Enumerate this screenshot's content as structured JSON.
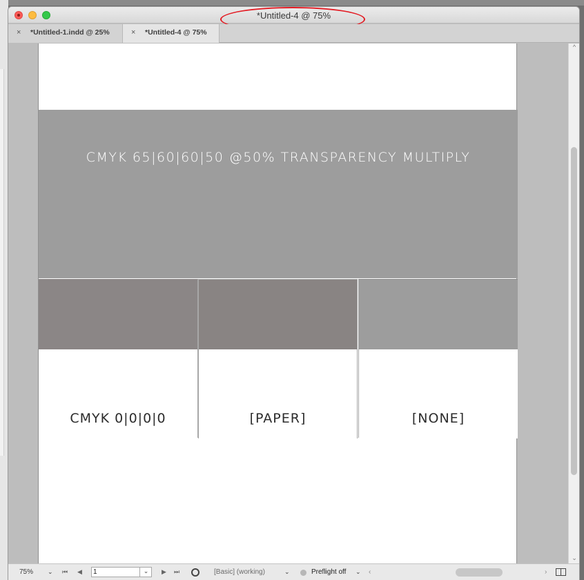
{
  "window": {
    "title": "*Untitled-4 @ 75%"
  },
  "tabs": [
    {
      "label": "*Untitled-1.indd @ 25%",
      "close": "×"
    },
    {
      "label": "*Untitled-4 @ 75%",
      "close": "×"
    }
  ],
  "document": {
    "big_bar_label": "CMYK 65|60|60|50  @50%   TRANSPARENCY  MULTIPLY",
    "swatches": [
      {
        "label": "CMYK 0|0|0|0"
      },
      {
        "label": "[PAPER]"
      },
      {
        "label": "[NONE]"
      }
    ]
  },
  "statusbar": {
    "zoom": "75%",
    "page": "1",
    "preflight_profile": "[Basic] (working)",
    "preflight": "Preflight off",
    "caret": "⌄",
    "first": "⏮",
    "prev": "◀",
    "next": "▶",
    "last": "⏭",
    "left_arrow": "‹",
    "right_arrow": "›"
  },
  "scrollbar": {
    "up": "^",
    "down": "⌄"
  },
  "colors": {
    "big_bar": "#9d9d9d",
    "swatch_dark": "#898483",
    "annotation": "#e31b23"
  }
}
